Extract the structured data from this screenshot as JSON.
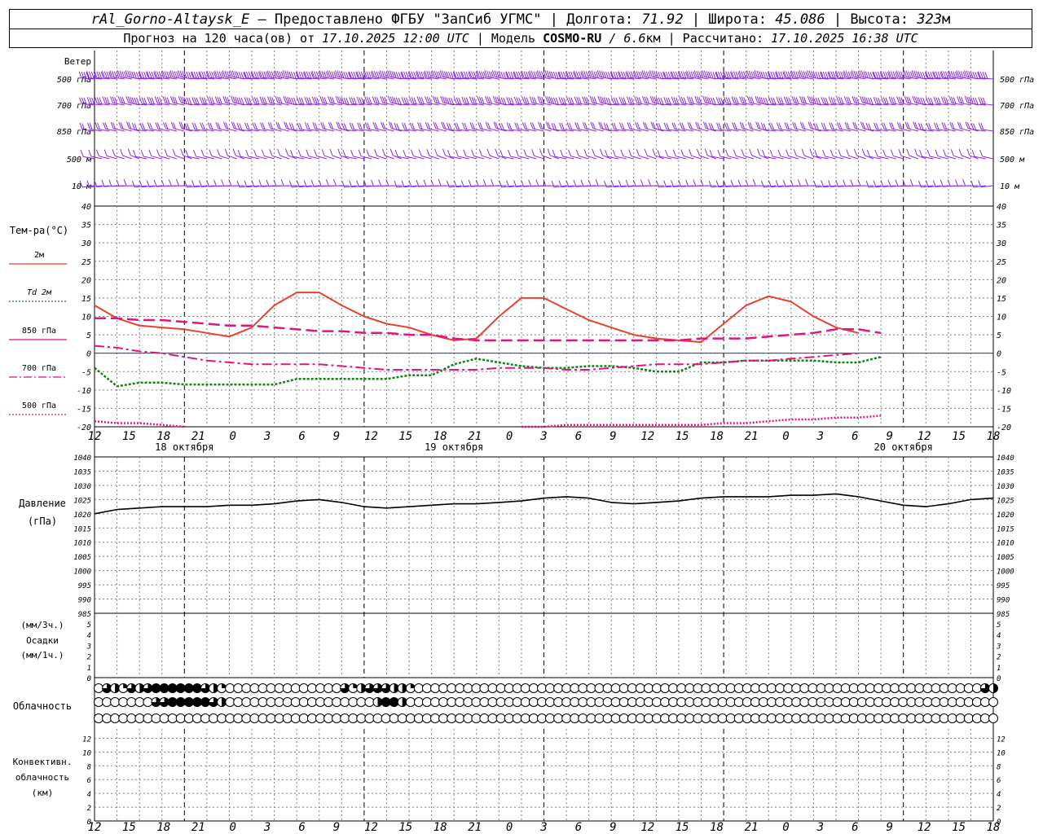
{
  "header": {
    "station": "rAl_Gorno-Altaysk_E",
    "provider": "– Предоставлено ФГБУ \"ЗапСиб УГМС\" |",
    "lon_label": "Долгота:",
    "lon": "71.92",
    "lat_label": "| Широта:",
    "lat": "45.086",
    "alt_label": "| Высота:",
    "alt": "323",
    "alt_unit": "м",
    "fc_prefix": "Прогноз на 120 часа(ов) от",
    "fc_start": "17.10.2025 12:00 UTC",
    "model_label": "| Модель",
    "model": "COSMO-RU",
    "model_res": "/ 6.6",
    "model_res_unit": "км",
    "calc_label": "| Рассчитано:",
    "calc_time": "17.10.2025 16:38 UTC"
  },
  "labels": {
    "wind_title": "Ветер",
    "wind_levels": [
      "500 гПа",
      "700 гПа",
      "850 гПа",
      "500 м",
      "10 м"
    ],
    "temp_title": "Тем-ра(°С)",
    "legend": [
      {
        "label": "2м",
        "color": "#e8412c",
        "dash": ""
      },
      {
        "label": "Td 2м",
        "color": "#148214",
        "dash": "2,2"
      },
      {
        "label": "850 гПа",
        "color": "#e0157f",
        "dash": ""
      },
      {
        "label": "700 гПа",
        "color": "#e0157f",
        "dash": "10,3,2,3"
      },
      {
        "label": "500 гПа",
        "color": "#e0157f",
        "dash": "2,2"
      }
    ],
    "pressure_title": "Давление",
    "pressure_unit": "(гПа)",
    "precip_unit3": "(мм/3ч.)",
    "precip_title": "Осадки",
    "precip_unit1": "(мм/1ч.)",
    "cloud_title": "Облачность",
    "conv_title1": "Конвективн.",
    "conv_title2": "облачность",
    "conv_unit": "(км)",
    "day_labels": [
      "18 октября",
      "19 октября",
      "20 октября"
    ]
  },
  "chart_data": [
    {
      "type": "line",
      "title": "Тем-ра(°С)",
      "x_hours": [
        0,
        3,
        6,
        9,
        12,
        15,
        18,
        21,
        24,
        27,
        30,
        33,
        36,
        39,
        42,
        45,
        48,
        51,
        54,
        57,
        60,
        63,
        66,
        69,
        72,
        75,
        78,
        81,
        84,
        87,
        90,
        93,
        96,
        99,
        102,
        105,
        108,
        111,
        114,
        117,
        120
      ],
      "x_tick_labels": [
        "12",
        "15",
        "18",
        "21",
        "0",
        "3",
        "6",
        "9",
        "12",
        "15",
        "18",
        "21",
        "0",
        "3",
        "6",
        "9",
        "12",
        "15",
        "18",
        "21",
        "0",
        "3",
        "6",
        "9",
        "12",
        "15",
        "18"
      ],
      "ylim": [
        -20,
        40
      ],
      "series": [
        {
          "name": "2м",
          "values": [
            13,
            9.5,
            7.5,
            7,
            6.5,
            5.5,
            4.5,
            7,
            13,
            16.5,
            16.5,
            13,
            10,
            8,
            7,
            5,
            3.5,
            4,
            10,
            15,
            15,
            12,
            9,
            7,
            5,
            4,
            3.5,
            3,
            8,
            13,
            15.5,
            14,
            10,
            7,
            5.5,
            null,
            null,
            null,
            null,
            null,
            null
          ]
        },
        {
          "name": "Td 2м",
          "values": [
            -4,
            -9,
            -8,
            -8,
            -8.5,
            -8.5,
            -8.5,
            -8.5,
            -8.5,
            -7,
            -7,
            -7,
            -7,
            -7,
            -6,
            -6,
            -3,
            -1.5,
            -2.5,
            -3.5,
            -4,
            -4,
            -3.5,
            -3.5,
            -4,
            -5,
            -5,
            -2.5,
            -2.5,
            -2,
            -2,
            -2,
            -2,
            -2.5,
            -2.5,
            -1,
            null,
            null,
            null,
            null,
            null
          ]
        },
        {
          "name": "850 гПа",
          "values": [
            9.5,
            9.5,
            9,
            9,
            8.5,
            8,
            7.5,
            7.5,
            7,
            6.5,
            6,
            6,
            5.5,
            5.5,
            5,
            5,
            4,
            3.5,
            3.5,
            3.5,
            3.5,
            3.5,
            3.5,
            3.5,
            3.5,
            3.5,
            3.5,
            4,
            4,
            4,
            4.5,
            5,
            5.5,
            6.5,
            6.5,
            5.5,
            null,
            null,
            null,
            null,
            null
          ]
        },
        {
          "name": "700 гПа",
          "values": [
            2,
            1.5,
            0.5,
            0,
            -1,
            -2,
            -2.5,
            -3,
            -3,
            -3,
            -3,
            -3.5,
            -4,
            -4.5,
            -4.5,
            -4.5,
            -4.5,
            -4.5,
            -4,
            -4,
            -4,
            -4.5,
            -4.5,
            -4,
            -3.5,
            -3,
            -3,
            -3,
            -2.5,
            -2,
            -2,
            -1.5,
            -1,
            -0.5,
            0,
            null,
            null,
            null,
            null,
            null,
            null
          ]
        },
        {
          "name": "500 гПа",
          "values": [
            -18.5,
            -19,
            -19,
            -19.5,
            -20.5,
            null,
            null,
            null,
            null,
            null,
            null,
            null,
            null,
            null,
            null,
            null,
            null,
            null,
            null,
            -20.5,
            -20,
            -19.5,
            -19.5,
            -19.5,
            -19.5,
            -19.5,
            -19.5,
            -19.5,
            -19,
            -19,
            -18.5,
            -18,
            -18,
            -17.5,
            -17.5,
            -17,
            null,
            null,
            null,
            null,
            null
          ]
        }
      ]
    },
    {
      "type": "line",
      "title": "Давление",
      "ylabel": "(гПа)",
      "ylim": [
        985,
        1040
      ],
      "series": [
        {
          "name": "Давление",
          "values": [
            1020,
            1021.5,
            1022,
            1022.5,
            1022.5,
            1022.5,
            1023,
            1023,
            1023.5,
            1024.5,
            1025,
            1024,
            1022.5,
            1022,
            1022.5,
            1023,
            1023.5,
            1023.5,
            1024,
            1024.5,
            1025.5,
            1026,
            1025.5,
            1024,
            1023.5,
            1024,
            1024.5,
            1025.5,
            1026,
            1026,
            1026,
            1026.5,
            1026.5,
            1027,
            1026,
            1024.5,
            1023,
            1022.5,
            1023.5,
            1025,
            1025.5
          ]
        }
      ]
    },
    {
      "type": "bar",
      "title": "Осадки",
      "ylim": [
        0,
        5
      ],
      "values": []
    },
    {
      "type": "table",
      "title": "Облачность",
      "rows_count": 3,
      "per_hour": true,
      "cloud_upper": {
        "1": 3,
        "2": 2,
        "3": 1,
        "4": 3,
        "5": 2,
        "6": 3,
        "7": 4,
        "8": 4,
        "9": 4,
        "10": 4,
        "11": 4,
        "12": 4,
        "13": 3,
        "14": 2,
        "15": 1,
        "30": 3,
        "31": 1,
        "32": 2,
        "33": 3,
        "34": 3,
        "35": 3,
        "36": 2,
        "37": 2,
        "38": 1,
        "100": 0,
        "101": 0,
        "102": 0,
        "103": 0,
        "104": 0,
        "105": 0,
        "106": 0,
        "107": 0,
        "108": 3,
        "109": 2
      },
      "cloud_middle": {
        "7": 3,
        "8": 3,
        "9": 4,
        "10": 4,
        "11": 4,
        "12": 4,
        "13": 4,
        "14": 3,
        "15": 2,
        "34": 2,
        "35": 4,
        "36": 4,
        "37": 2
      },
      "cloud_lower": {}
    },
    {
      "type": "bar",
      "title": "Конвективн. облачность (км)",
      "ylim": [
        0,
        13
      ],
      "values": []
    }
  ],
  "wind_rows": {
    "500 гПа": {
      "speed": [
        35,
        35,
        35,
        35,
        35,
        35,
        35,
        35,
        35,
        35,
        35,
        35,
        35,
        35,
        35,
        35,
        35,
        35,
        35,
        35,
        35,
        35,
        35,
        35,
        35,
        35,
        35,
        35,
        35,
        35,
        35,
        35,
        35,
        35,
        35,
        35,
        35,
        35,
        35,
        35,
        35
      ],
      "dir": 280
    },
    "700 гПа": {
      "speed": [
        25,
        25,
        25,
        25,
        25,
        25,
        25,
        25,
        25,
        25,
        25,
        25,
        25,
        25,
        25,
        25,
        25,
        25,
        25,
        25,
        25,
        25,
        25,
        25,
        25,
        25,
        25,
        25,
        25,
        25,
        25,
        25,
        25,
        25,
        25,
        25,
        25,
        25,
        25,
        25,
        25
      ],
      "dir": 285
    },
    "850 гПа": {
      "speed": [
        20,
        20,
        20,
        20,
        20,
        20,
        20,
        20,
        20,
        20,
        20,
        20,
        20,
        20,
        20,
        20,
        20,
        20,
        20,
        20,
        20,
        20,
        20,
        20,
        20,
        20,
        20,
        20,
        20,
        20,
        20,
        20,
        20,
        20,
        20,
        20,
        20,
        20,
        20,
        20,
        20
      ],
      "dir": 290
    },
    "500 м": {
      "speed": [
        12,
        12,
        12,
        12,
        12,
        12,
        12,
        12,
        12,
        12,
        12,
        12,
        12,
        12,
        12,
        12,
        12,
        12,
        12,
        12,
        12,
        12,
        12,
        12,
        12,
        12,
        12,
        12,
        12,
        12,
        12,
        12,
        12,
        12,
        12,
        12,
        12,
        12,
        12,
        12,
        12
      ],
      "dir": 300
    },
    "10 м": {
      "speed": [
        8,
        8,
        8,
        8,
        8,
        8,
        8,
        8,
        8,
        8,
        8,
        8,
        8,
        8,
        8,
        8,
        8,
        8,
        8,
        8,
        8,
        8,
        8,
        8,
        8,
        8,
        8,
        8,
        8,
        8,
        8,
        8,
        8,
        8,
        8,
        8,
        8,
        8,
        8,
        8,
        8
      ],
      "dir": 250
    }
  },
  "colors": {
    "wind": "#8a2be2",
    "temp2m": "#e8412c",
    "td": "#148214",
    "upper": "#e0157f",
    "zero_line": "#2a2ad6",
    "grid": "#808080"
  }
}
